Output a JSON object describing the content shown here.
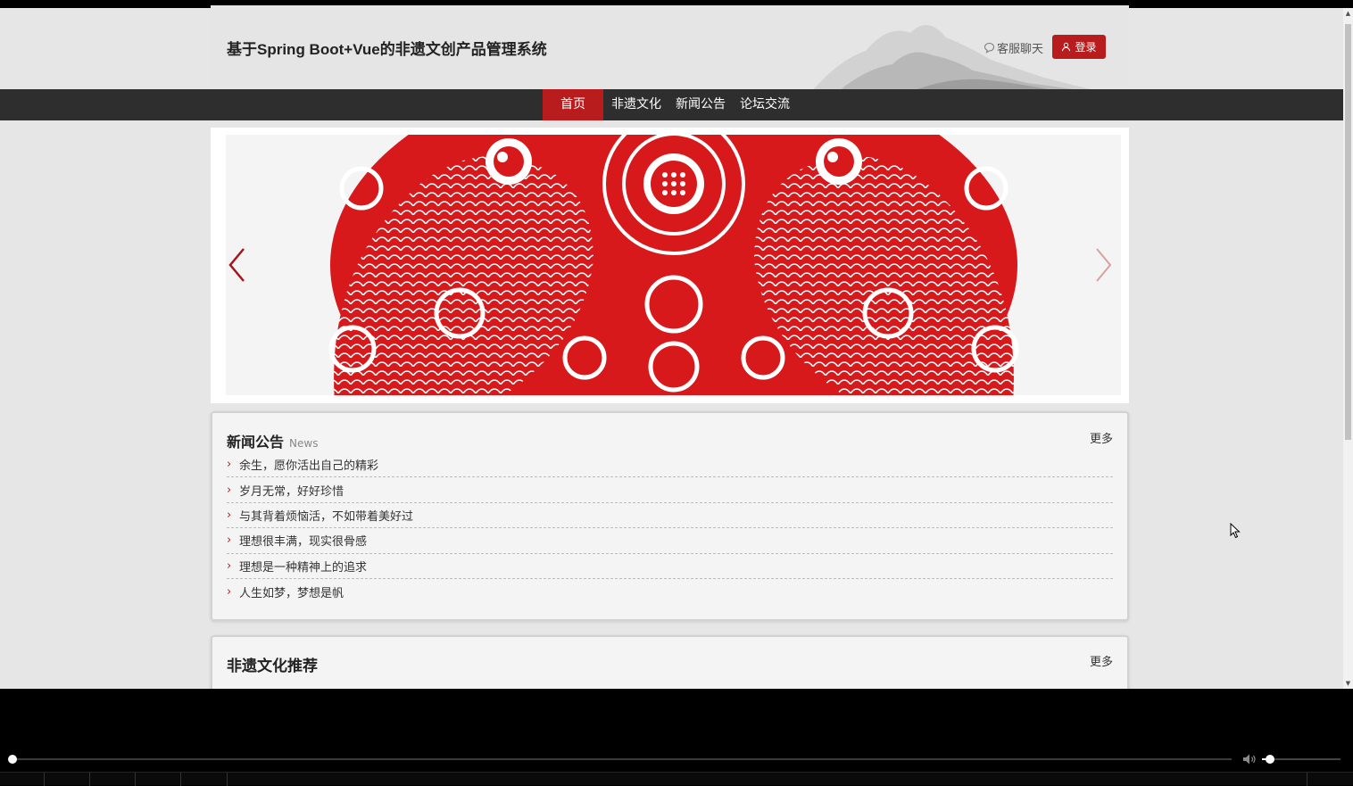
{
  "header": {
    "site_title": "基于Spring Boot+Vue的非遗文创产品管理系统",
    "chat_label": "客服聊天",
    "login_label": "登录"
  },
  "nav": {
    "items": [
      "首页",
      "非遗文化",
      "新闻公告",
      "论坛交流"
    ],
    "active_index": 0
  },
  "news": {
    "title": "新闻公告",
    "subtitle": "News",
    "more_label": "更多",
    "items": [
      "余生，愿你活出自己的精彩",
      "岁月无常，好好珍惜",
      "与其背着烦恼活，不如带着美好过",
      "理想很丰满，现实很骨感",
      "理想是一种精神上的追求",
      "人生如梦，梦想是帆"
    ]
  },
  "recommend": {
    "title": "非遗文化推荐",
    "more_label": "更多"
  },
  "player": {
    "progress": 0.0,
    "volume": 0.1
  },
  "colors": {
    "accent": "#b81c1c",
    "nav_bg": "#2e2e2e",
    "page_bg": "#e6e6e6",
    "papercut_red": "#d8191c"
  }
}
